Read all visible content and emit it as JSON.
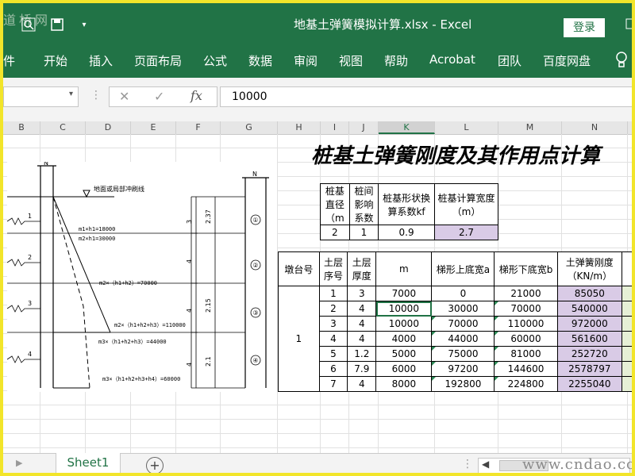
{
  "watermark_top": "道桥网",
  "watermark_bottom": "www.cndao.com",
  "title": {
    "file": "地基土弹簧模拟计算.xlsx",
    "sep": "-",
    "app": "Excel"
  },
  "login_label": "登录",
  "ribbon_tabs": [
    "件",
    "开始",
    "插入",
    "页面布局",
    "公式",
    "数据",
    "审阅",
    "视图",
    "帮助",
    "Acrobat",
    "团队",
    "百度网盘"
  ],
  "formula": {
    "value": "10000"
  },
  "columns": [
    "B",
    "C",
    "D",
    "E",
    "F",
    "G",
    "H",
    "I",
    "J",
    "K",
    "L",
    "M",
    "N"
  ],
  "selected_column": "K",
  "sheet_title": "桩基土弹簧刚度及其作用点计算",
  "table1": {
    "headers": [
      "桩基直径（m",
      "桩间影响系数",
      "桩基形状换算系数kf",
      "桩基计算宽度（m）"
    ],
    "values": [
      "2",
      "1",
      "0.9",
      "2.7"
    ]
  },
  "table2": {
    "headers": [
      "墩台号",
      "土层序号",
      "土层厚度",
      "m",
      "梯形上底宽a",
      "梯形下底宽b",
      "土弹簧刚度（KN/m）"
    ],
    "pier_id": "1",
    "rows": [
      [
        "1",
        "3",
        "7000",
        "0",
        "21000",
        "85050"
      ],
      [
        "2",
        "4",
        "10000",
        "30000",
        "70000",
        "540000"
      ],
      [
        "3",
        "4",
        "10000",
        "70000",
        "110000",
        "972000"
      ],
      [
        "4",
        "4",
        "4000",
        "44000",
        "60000",
        "561600"
      ],
      [
        "5",
        "1.2",
        "5000",
        "75000",
        "81000",
        "252720"
      ],
      [
        "6",
        "7.9",
        "6000",
        "97200",
        "144600",
        "2578797"
      ],
      [
        "7",
        "4",
        "8000",
        "192800",
        "224800",
        "2255040"
      ]
    ]
  },
  "drawing": {
    "ground_label": "地面或局部冲刷线",
    "layer_numbers": [
      "1",
      "2",
      "3",
      "4"
    ],
    "right_layer_numbers": [
      "①",
      "②",
      "③",
      "④"
    ],
    "pile_top_label": "N",
    "dims": [
      "3",
      "2.37",
      "4",
      "2.15",
      "4",
      "2.1",
      "4"
    ],
    "annotations": [
      "m1×h1=18000",
      "m2×h1=30000",
      "m2×（h1+h2）=70000",
      "m2×（h1+h2+h3）=110000",
      "m3×（h1+h2+h3）=44000",
      "m3×（h1+h2+h3+h4）=60000"
    ]
  },
  "sheet_tab": "Sheet1",
  "colors": {
    "excel_green": "#217346",
    "purple_fill": "#d9cbe6",
    "frame_yellow": "#f2e52a"
  }
}
